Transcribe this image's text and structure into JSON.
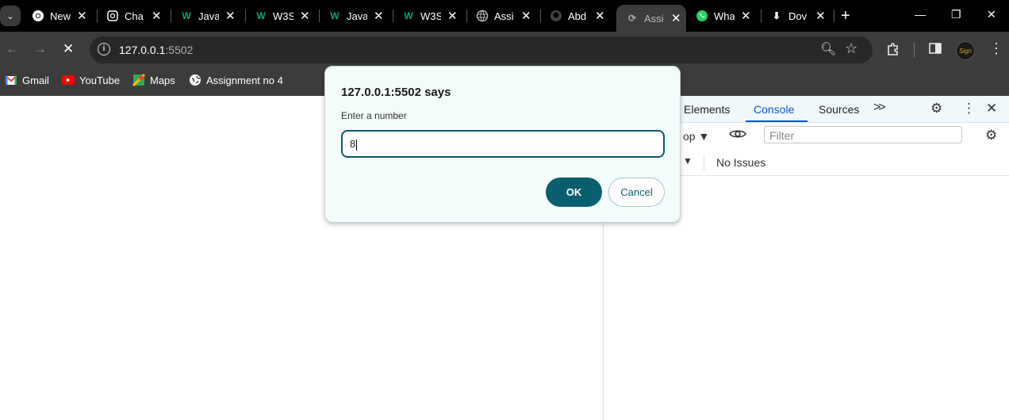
{
  "tabs": [
    {
      "title": "New",
      "icon": "chrome-icon"
    },
    {
      "title": "Cha",
      "icon": "chatgpt-icon"
    },
    {
      "title": "Java",
      "icon": "w3schools-icon"
    },
    {
      "title": "W3S",
      "icon": "w3schools-icon"
    },
    {
      "title": "Java",
      "icon": "w3schools-icon"
    },
    {
      "title": "W3S",
      "icon": "w3schools-icon"
    },
    {
      "title": "Assi",
      "icon": "globe-icon"
    },
    {
      "title": "Abd",
      "icon": "github-icon"
    },
    {
      "title": "Assi",
      "icon": "loading-icon",
      "active": true
    },
    {
      "title": "Wha",
      "icon": "whatsapp-icon"
    },
    {
      "title": "Dov",
      "icon": "download-icon"
    }
  ],
  "address": {
    "host": "127.0.0.1",
    "port": ":5502"
  },
  "bookmarks": [
    {
      "label": "Gmail",
      "icon": "gmail-icon"
    },
    {
      "label": "YouTube",
      "icon": "youtube-icon"
    },
    {
      "label": "Maps",
      "icon": "maps-icon"
    },
    {
      "label": "Assignment no 4",
      "icon": "globe-icon"
    }
  ],
  "dialog": {
    "title": "127.0.0.1:5502 says",
    "message": "Enter a number",
    "input_value": "8",
    "ok_label": "OK",
    "cancel_label": "Cancel"
  },
  "devtools": {
    "tabs": [
      "Elements",
      "Console",
      "Sources"
    ],
    "active_tab": "Console",
    "context": "op",
    "filter_placeholder": "Filter",
    "issues": "No Issues"
  },
  "colors": {
    "accent": "#0a5f6e",
    "devtools_active": "#0b57d0",
    "tabstrip": "#000000",
    "toolbar": "#3c3c3c"
  }
}
